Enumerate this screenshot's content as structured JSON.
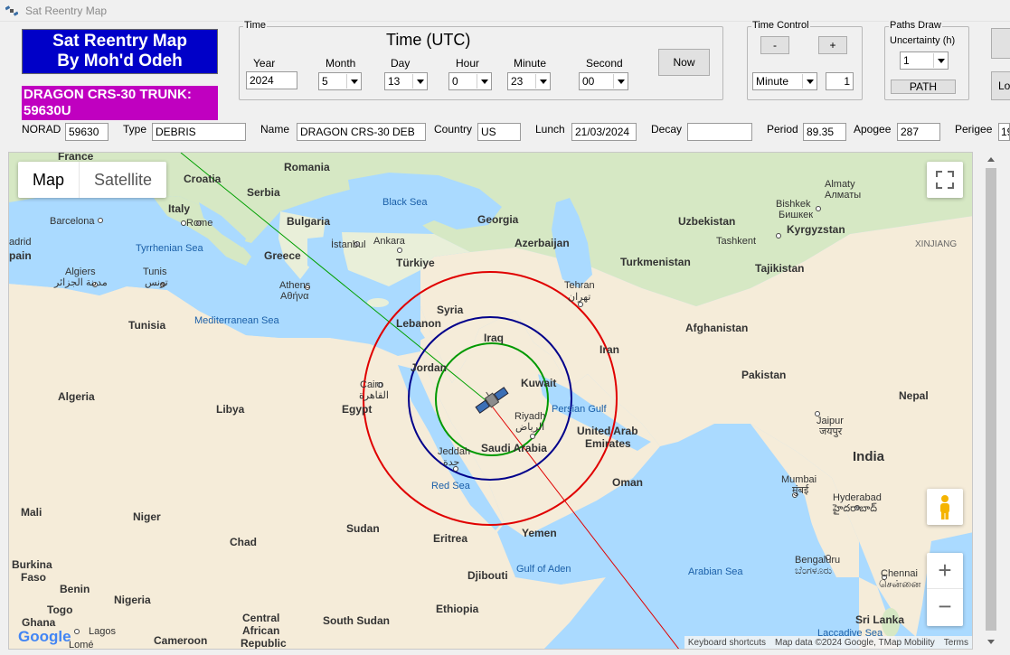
{
  "window": {
    "title": "Sat Reentry Map"
  },
  "banner": {
    "line1": "Sat Reentry Map",
    "line2": "By Moh'd Odeh"
  },
  "satellite_label": {
    "line1": "DRAGON CRS-30 TRUNK:",
    "line2": "59630U"
  },
  "time_group": {
    "title": "Time",
    "heading": "Time (UTC)",
    "year": {
      "label": "Year",
      "value": "2024"
    },
    "month": {
      "label": "Month",
      "value": "5"
    },
    "day": {
      "label": "Day",
      "value": "13"
    },
    "hour": {
      "label": "Hour",
      "value": "0"
    },
    "minute": {
      "label": "Minute",
      "value": "23"
    },
    "second": {
      "label": "Second",
      "value": "00"
    },
    "now_button": "Now"
  },
  "time_control": {
    "title": "Time Control",
    "minus": "-",
    "plus": "+",
    "unit": "Minute",
    "step": "1"
  },
  "paths_draw": {
    "title": "Paths Draw",
    "uncertainty_label": "Uncertainty (h)",
    "uncertainty_value": "1",
    "path_button": "PATH"
  },
  "side_buttons": {
    "lower_partial": "Lo"
  },
  "info": {
    "norad": {
      "label": "NORAD",
      "value": "59630"
    },
    "type": {
      "label": "Type",
      "value": "DEBRIS"
    },
    "name": {
      "label": "Name",
      "value": "DRAGON CRS-30 DEB"
    },
    "country": {
      "label": "Country",
      "value": "US"
    },
    "launch": {
      "label": "Lunch",
      "value": "21/03/2024"
    },
    "decay": {
      "label": "Decay",
      "value": ""
    },
    "period": {
      "label": "Period",
      "value": "89.35"
    },
    "apogee": {
      "label": "Apogee",
      "value": "287"
    },
    "perigee": {
      "label": "Perigee",
      "value": "19"
    }
  },
  "map": {
    "type_map": "Map",
    "type_satellite": "Satellite",
    "attribution": [
      "Keyboard shortcuts",
      "Map data ©2024 Google, TMap Mobility",
      "Terms"
    ],
    "logo": "Google",
    "zoom_in": "+",
    "zoom_out": "−",
    "colors": {
      "water": "#aadaff",
      "land": "#f2efe9",
      "green_land": "#d6e8c4",
      "desert": "#f5ecd9",
      "ring_outer": "#e00000",
      "ring_mid": "#00008b",
      "ring_inner": "#009900",
      "track_in": "#00a000",
      "track_out": "#e00000"
    },
    "places": {
      "france": "France",
      "romania": "Romania",
      "croatia": "Croatia",
      "serbia": "Serbia",
      "italy": "Italy",
      "rome": "Rome",
      "barcelona": "Barcelona",
      "madrid": "adrid",
      "spain": "pain",
      "bulgaria": "Bulgaria",
      "istanbul": "İstanbul",
      "black_sea": "Black Sea",
      "georgia": "Georgia",
      "tyrrhenian": "Tyrrhenian Sea",
      "ankara": "Ankara",
      "azerbaijan": "Azerbaijan",
      "uzbekistan": "Uzbekistan",
      "tashkent": "Tashkent",
      "bishkek": "Bishkek",
      "bishkek_local": "Бишкек",
      "almaty": "Almaty",
      "almaty_local": "Алматы",
      "kyrgyzstan": "Kyrgyzstan",
      "xinjiang": "XINJIANG",
      "algiers": "Algiers",
      "algiers_local": "مدينة الجزائر",
      "tunis": "Tunis",
      "tunis_local": "تونس",
      "greece": "Greece",
      "athens": "Athens",
      "athens_local": "Αθήνα",
      "turkiye": "Türkiye",
      "turkmenistan": "Turkmenistan",
      "tajikistan": "Tajikistan",
      "tehran": "Tehran",
      "tehran_local": "تهران",
      "syria": "Syria",
      "mediterranean": "Mediterranean Sea",
      "tunisia": "Tunisia",
      "lebanon": "Lebanon",
      "afghanistan": "Afghanistan",
      "iraq": "Iraq",
      "iran": "Iran",
      "jordan": "Jordan",
      "pakistan": "Pakistan",
      "algeria": "Algeria",
      "cairo": "Cairo",
      "cairo_local": "القاهرة",
      "kuwait": "Kuwait",
      "libya": "Libya",
      "egypt": "Egypt",
      "riyadh": "Riyadh",
      "riyadh_local": "الرياض",
      "persian_gulf": "Persian Gulf",
      "nepal": "Nepal",
      "uae1": "United Arab",
      "uae2": "Emirates",
      "jaipur": "Jaipur",
      "jaipur_local": "जयपुर",
      "jeddah": "Jeddah",
      "jeddah_local": "جدة",
      "saudi": "Saudi Arabia",
      "india": "India",
      "red_sea": "Red Sea",
      "oman": "Oman",
      "mumbai": "Mumbai",
      "mumbai_local": "मुंबई",
      "hyderabad": "Hyderabad",
      "hyderabad_local": "హైదరాబాద్",
      "mali": "Mali",
      "niger": "Niger",
      "sudan": "Sudan",
      "chad": "Chad",
      "eritrea": "Eritrea",
      "yemen": "Yemen",
      "burkina1": "Burkina",
      "burkina2": "Faso",
      "gulf_aden": "Gulf of Aden",
      "djibouti": "Djibouti",
      "bengaluru": "Bengaluru",
      "bengaluru_local": "ಬೆಂಗಳೂರು",
      "chennai": "Chennai",
      "chennai_local": "சென்னை",
      "arabian_sea": "Arabian Sea",
      "benin": "Benin",
      "nigeria": "Nigeria",
      "togo": "Togo",
      "ethiopia": "Ethiopia",
      "ghana": "Ghana",
      "lagos": "Lagos",
      "car1": "Central",
      "car2": "African",
      "car3": "Republic",
      "south_sudan": "South Sudan",
      "cameroon": "Cameroon",
      "lome": "Lomé",
      "sri_lanka": "Sri Lanka",
      "laccadive": "Laccadive Sea"
    }
  }
}
